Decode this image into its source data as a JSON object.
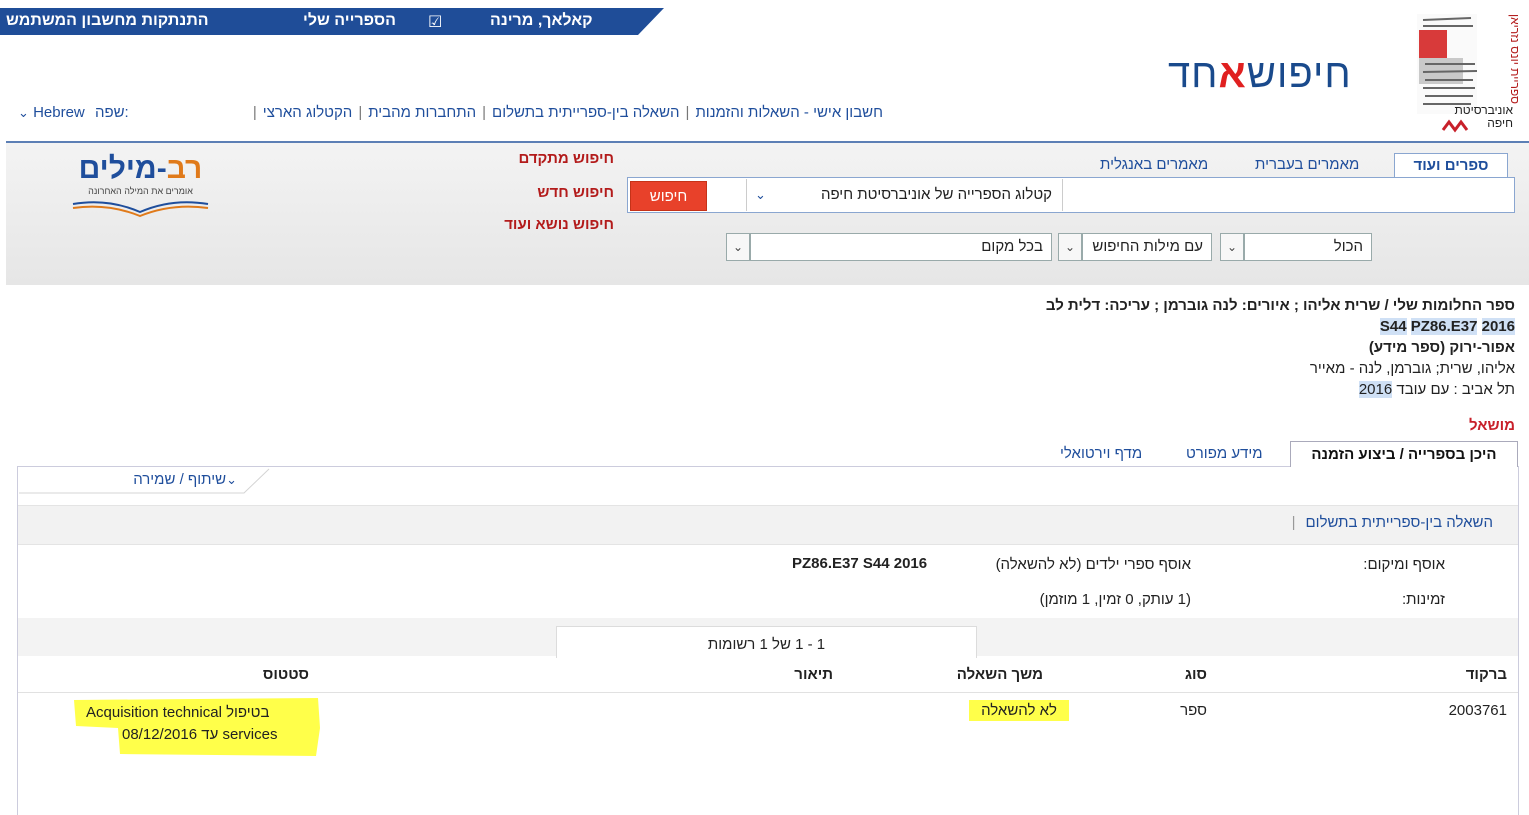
{
  "user_bar": {
    "user_name": "קאלאך, מרינה",
    "my_library": "הספרייה שלי",
    "logout": "התנתקות מחשבון המשתמש",
    "checkbox_glyph": "☑",
    "color": "#1f4d98"
  },
  "logos": {
    "univ_text_top": "ספריית יונס נזריאן",
    "univ_text_bottom": "אוניברסיטת חיפה",
    "primo_prefix": "חיפוש",
    "primo_aleph": "א",
    "primo_suffix": "חד",
    "ravmilim_main_a": "רב",
    "ravmilim_main_b": "-מילים",
    "ravmilim_sub": "אומרים את המילה האחרונה"
  },
  "nav": {
    "items": [
      "חשבון אישי - השאלות והזמנות",
      "השאלה בין-ספרייתית בתשלום",
      "התחברות מהבית",
      "הקטלוג הארצי"
    ],
    "lang_label": "שפה:",
    "lang_value": "Hebrew",
    "lang_chevron": "⌄"
  },
  "search": {
    "tabs": [
      "ספרים ועוד",
      "מאמרים בעברית",
      "מאמרים באנגלית"
    ],
    "query": "",
    "scope": "קטלוג הספרייה של אוניברסיטת חיפה",
    "button": "חיפוש",
    "advanced": "חיפוש מתקדם",
    "new_search": "חיפוש חדש",
    "subject_search": "חיפוש נושא ועוד",
    "filter1": "הכול",
    "filter2": "עם מילות החיפוש",
    "filter3": "בכל מקום",
    "arrow": "⌄",
    "accent": "#e8412a"
  },
  "record": {
    "title": "ספר החלומות שלי / שרית אליהו ; איורים: לנה גוברמן ; עריכה: דלית לב",
    "call_a": "PZ86.E37",
    "call_b": "S44",
    "call_c": "2016",
    "series": "אפור-ירוק (ספר מידע)",
    "authors": "אליהו, שרית; גוברמן, לנה - מאייר",
    "pub_prefix": "תל אביב : עם עובד",
    "pub_year": "2016",
    "status": "מושאל"
  },
  "detail_tabs": [
    "היכן בספרייה / ביצוע הזמנה",
    "מידע מפורט",
    "מדף וירטואלי"
  ],
  "detail": {
    "share": "שיתוף / שמירה",
    "share_chevron": "⌄",
    "ill": "השאלה בין-ספרייתית בתשלום",
    "location_label": "אוסף ומיקום:",
    "location_value": "אוסף ספרי ילדים (לא להשאלה)",
    "location_call": "PZ86.E37  S44  2016",
    "avail_label": "זמינות:",
    "avail_value": "(1 עותק, 0 זמין, 1 מוזמן)",
    "pager": "1 - 1 של 1 רשומות"
  },
  "items_table": {
    "headers": [
      "ברקוד",
      "סוג",
      "משך השאלה",
      "תיאור",
      "סטטוס"
    ],
    "rows": [
      {
        "barcode": "2003761",
        "type": "ספר",
        "loan": "לא להשאלה",
        "description": "",
        "status_line1_he": "בטיפול",
        "status_line1_en": "Acquisition technical",
        "status_line2_en": "services",
        "status_line2_he": "עד",
        "status_date": "08/12/2016"
      }
    ]
  }
}
